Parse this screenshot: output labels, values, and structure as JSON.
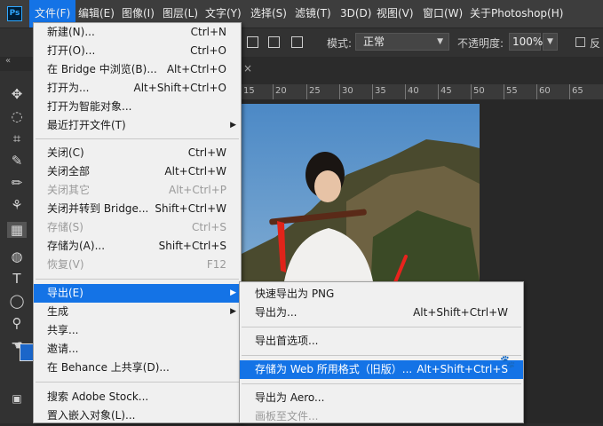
{
  "app": {
    "logo": "Ps"
  },
  "menubar": {
    "items": [
      "文件(F)",
      "编辑(E)",
      "图像(I)",
      "图层(L)",
      "文字(Y)",
      "选择(S)",
      "滤镜(T)",
      "3D(D)",
      "视图(V)",
      "窗口(W)",
      "关于Photoshop(H)"
    ]
  },
  "options": {
    "mode_label": "模式:",
    "mode_value": "正常",
    "opacity_label": "不透明度:",
    "opacity_value": "100%",
    "reverse_label": "反"
  },
  "panel": {
    "collapse": "«",
    "tab_close": "×"
  },
  "ruler": {
    "ticks": [
      "15",
      "20",
      "25",
      "30",
      "35",
      "40",
      "45",
      "50",
      "55",
      "60",
      "65"
    ]
  },
  "file_menu": {
    "items": [
      {
        "label": "新建(N)...",
        "shortcut": "Ctrl+N"
      },
      {
        "label": "打开(O)...",
        "shortcut": "Ctrl+O"
      },
      {
        "label": "在 Bridge 中浏览(B)...",
        "shortcut": "Alt+Ctrl+O"
      },
      {
        "label": "打开为...",
        "shortcut": "Alt+Shift+Ctrl+O"
      },
      {
        "label": "打开为智能对象...",
        "shortcut": ""
      },
      {
        "label": "最近打开文件(T)",
        "shortcut": ""
      },
      {
        "label": "关闭(C)",
        "shortcut": "Ctrl+W"
      },
      {
        "label": "关闭全部",
        "shortcut": "Alt+Ctrl+W"
      },
      {
        "label": "关闭其它",
        "shortcut": "Alt+Ctrl+P"
      },
      {
        "label": "关闭并转到 Bridge...",
        "shortcut": "Shift+Ctrl+W"
      },
      {
        "label": "存储(S)",
        "shortcut": "Ctrl+S"
      },
      {
        "label": "存储为(A)...",
        "shortcut": "Shift+Ctrl+S"
      },
      {
        "label": "恢复(V)",
        "shortcut": "F12"
      },
      {
        "label": "导出(E)",
        "shortcut": ""
      },
      {
        "label": "生成",
        "shortcut": ""
      },
      {
        "label": "共享...",
        "shortcut": ""
      },
      {
        "label": "邀请...",
        "shortcut": ""
      },
      {
        "label": "在 Behance 上共享(D)...",
        "shortcut": ""
      },
      {
        "label": "搜索 Adobe Stock...",
        "shortcut": ""
      },
      {
        "label": "置入嵌入对象(L)...",
        "shortcut": ""
      }
    ]
  },
  "export_menu": {
    "items": [
      {
        "label": "快速导出为 PNG",
        "shortcut": ""
      },
      {
        "label": "导出为...",
        "shortcut": "Alt+Shift+Ctrl+W"
      },
      {
        "label": "导出首选项...",
        "shortcut": ""
      },
      {
        "label": "存储为 Web 所用格式（旧版）...",
        "shortcut": "Alt+Shift+Ctrl+S"
      },
      {
        "label": "导出为 Aero...",
        "shortcut": ""
      },
      {
        "label": "画板至文件...",
        "shortcut": ""
      }
    ]
  },
  "colors": {
    "accent": "#1473e6",
    "arrow": "#e8231d"
  }
}
